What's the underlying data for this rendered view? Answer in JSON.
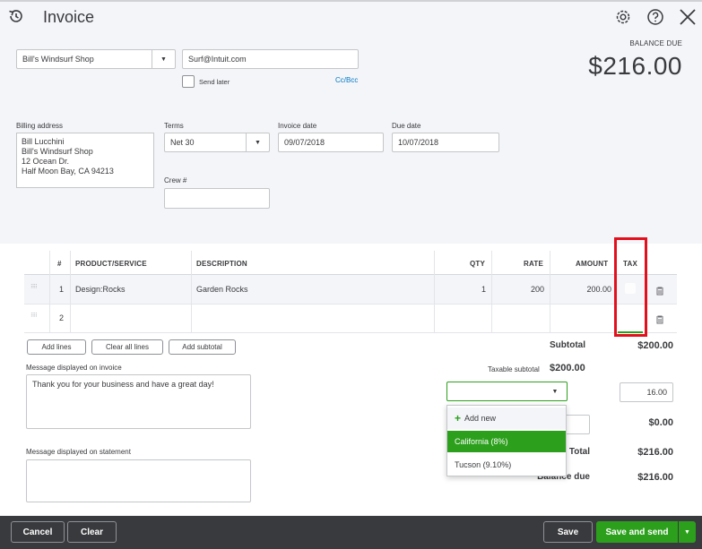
{
  "header": {
    "title": "Invoice",
    "balance_label": "BALANCE DUE",
    "balance_amount": "$216.00"
  },
  "customer": {
    "name": "Bill's Windsurf Shop",
    "email": "Surf@Intuit.com",
    "send_later_label": "Send later",
    "cc_bcc_label": "Cc/Bcc"
  },
  "billing": {
    "label": "Billing address",
    "lines": [
      "Bill Lucchini",
      "Bill's Windsurf Shop",
      "12 Ocean Dr.",
      "Half Moon Bay, CA  94213"
    ]
  },
  "terms": {
    "label": "Terms",
    "value": "Net 30"
  },
  "invoice_date": {
    "label": "Invoice date",
    "value": "09/07/2018"
  },
  "due_date": {
    "label": "Due date",
    "value": "10/07/2018"
  },
  "crew": {
    "label": "Crew #",
    "value": ""
  },
  "table": {
    "headers": {
      "num": "#",
      "product": "PRODUCT/SERVICE",
      "description": "DESCRIPTION",
      "qty": "QTY",
      "rate": "RATE",
      "amount": "AMOUNT",
      "tax": "TAX"
    },
    "rows": [
      {
        "num": "1",
        "product": "Design:Rocks",
        "description": "Garden Rocks",
        "qty": "1",
        "rate": "200",
        "amount": "200.00"
      },
      {
        "num": "2",
        "product": "",
        "description": "",
        "qty": "",
        "rate": "",
        "amount": ""
      }
    ]
  },
  "line_buttons": {
    "add_lines": "Add lines",
    "clear_all_lines": "Clear all lines",
    "add_subtotal": "Add subtotal"
  },
  "messages": {
    "invoice_label": "Message displayed on invoice",
    "invoice_text": "Thank you for your business and have a great day!",
    "statement_label": "Message displayed on statement",
    "statement_text": ""
  },
  "totals": {
    "subtotal_label": "Subtotal",
    "subtotal_value": "$200.00",
    "taxable_label": "Taxable subtotal",
    "taxable_value": "$200.00",
    "tax_input_value": "16.00",
    "shipping_value": "$0.00",
    "total_label": "Total",
    "total_value": "$216.00",
    "balance_due_label": "Balance due",
    "balance_due_value": "$216.00"
  },
  "tax_dropdown": {
    "add_new": "Add new",
    "options": [
      "California (8%)",
      "Tucson (9.10%)"
    ],
    "highlighted_index": 0
  },
  "footer": {
    "cancel": "Cancel",
    "clear": "Clear",
    "save": "Save",
    "save_and_send": "Save and send"
  },
  "colors": {
    "accent_green": "#2ca01c",
    "highlight_red": "#e2101d",
    "footer_bg": "#393a3d",
    "link_blue": "#0077c5"
  }
}
